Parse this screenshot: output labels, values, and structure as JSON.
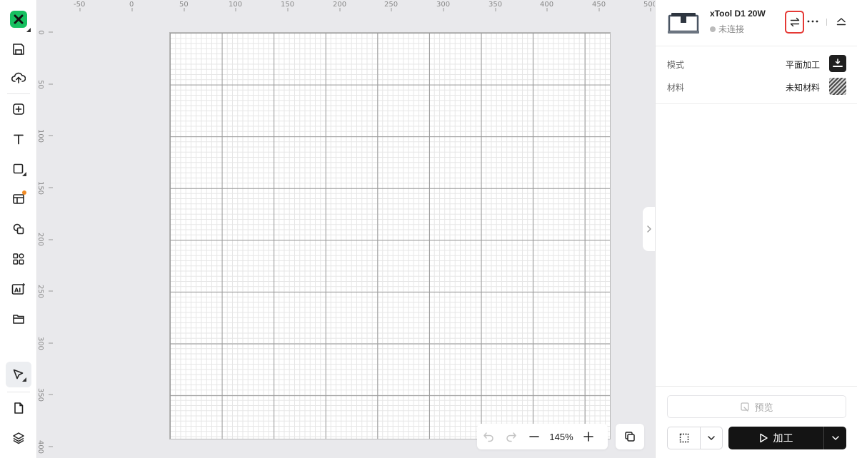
{
  "app": {
    "logo": "xtool-logo"
  },
  "toolbar": {
    "items": [
      {
        "name": "save",
        "icon": "save-icon"
      },
      {
        "name": "upload",
        "icon": "cloud-upload-icon"
      },
      {
        "name": "add",
        "icon": "plus-square-icon"
      },
      {
        "name": "text",
        "icon": "text-icon"
      },
      {
        "name": "shape",
        "icon": "square-icon"
      },
      {
        "name": "template",
        "icon": "layout-icon"
      },
      {
        "name": "combine",
        "icon": "overlap-icon"
      },
      {
        "name": "apps",
        "icon": "apps-icon"
      },
      {
        "name": "ai",
        "icon": "ai-icon"
      },
      {
        "name": "folder",
        "icon": "folder-icon"
      },
      {
        "name": "pen",
        "icon": "pen-tool-icon"
      },
      {
        "name": "file",
        "icon": "file-icon"
      },
      {
        "name": "layers",
        "icon": "layers-icon"
      }
    ]
  },
  "ruler": {
    "top": [
      "-50",
      "0",
      "50",
      "100",
      "150",
      "200",
      "250",
      "300",
      "350",
      "400",
      "450",
      "500"
    ],
    "left": [
      "0",
      "50",
      "100",
      "150",
      "200",
      "250",
      "300",
      "350",
      "400"
    ]
  },
  "zoom": {
    "value": "145%"
  },
  "device": {
    "name": "xTool D1 20W",
    "status": "未连接"
  },
  "props": {
    "mode_label": "模式",
    "mode_value": "平面加工",
    "material_label": "材料",
    "material_value": "未知材料"
  },
  "actions": {
    "preview": "预览",
    "process": "加工"
  },
  "colors": {
    "brand": "#16c060",
    "highlight": "#e53935",
    "notify": "#f08a24",
    "primary_button": "#141414"
  }
}
